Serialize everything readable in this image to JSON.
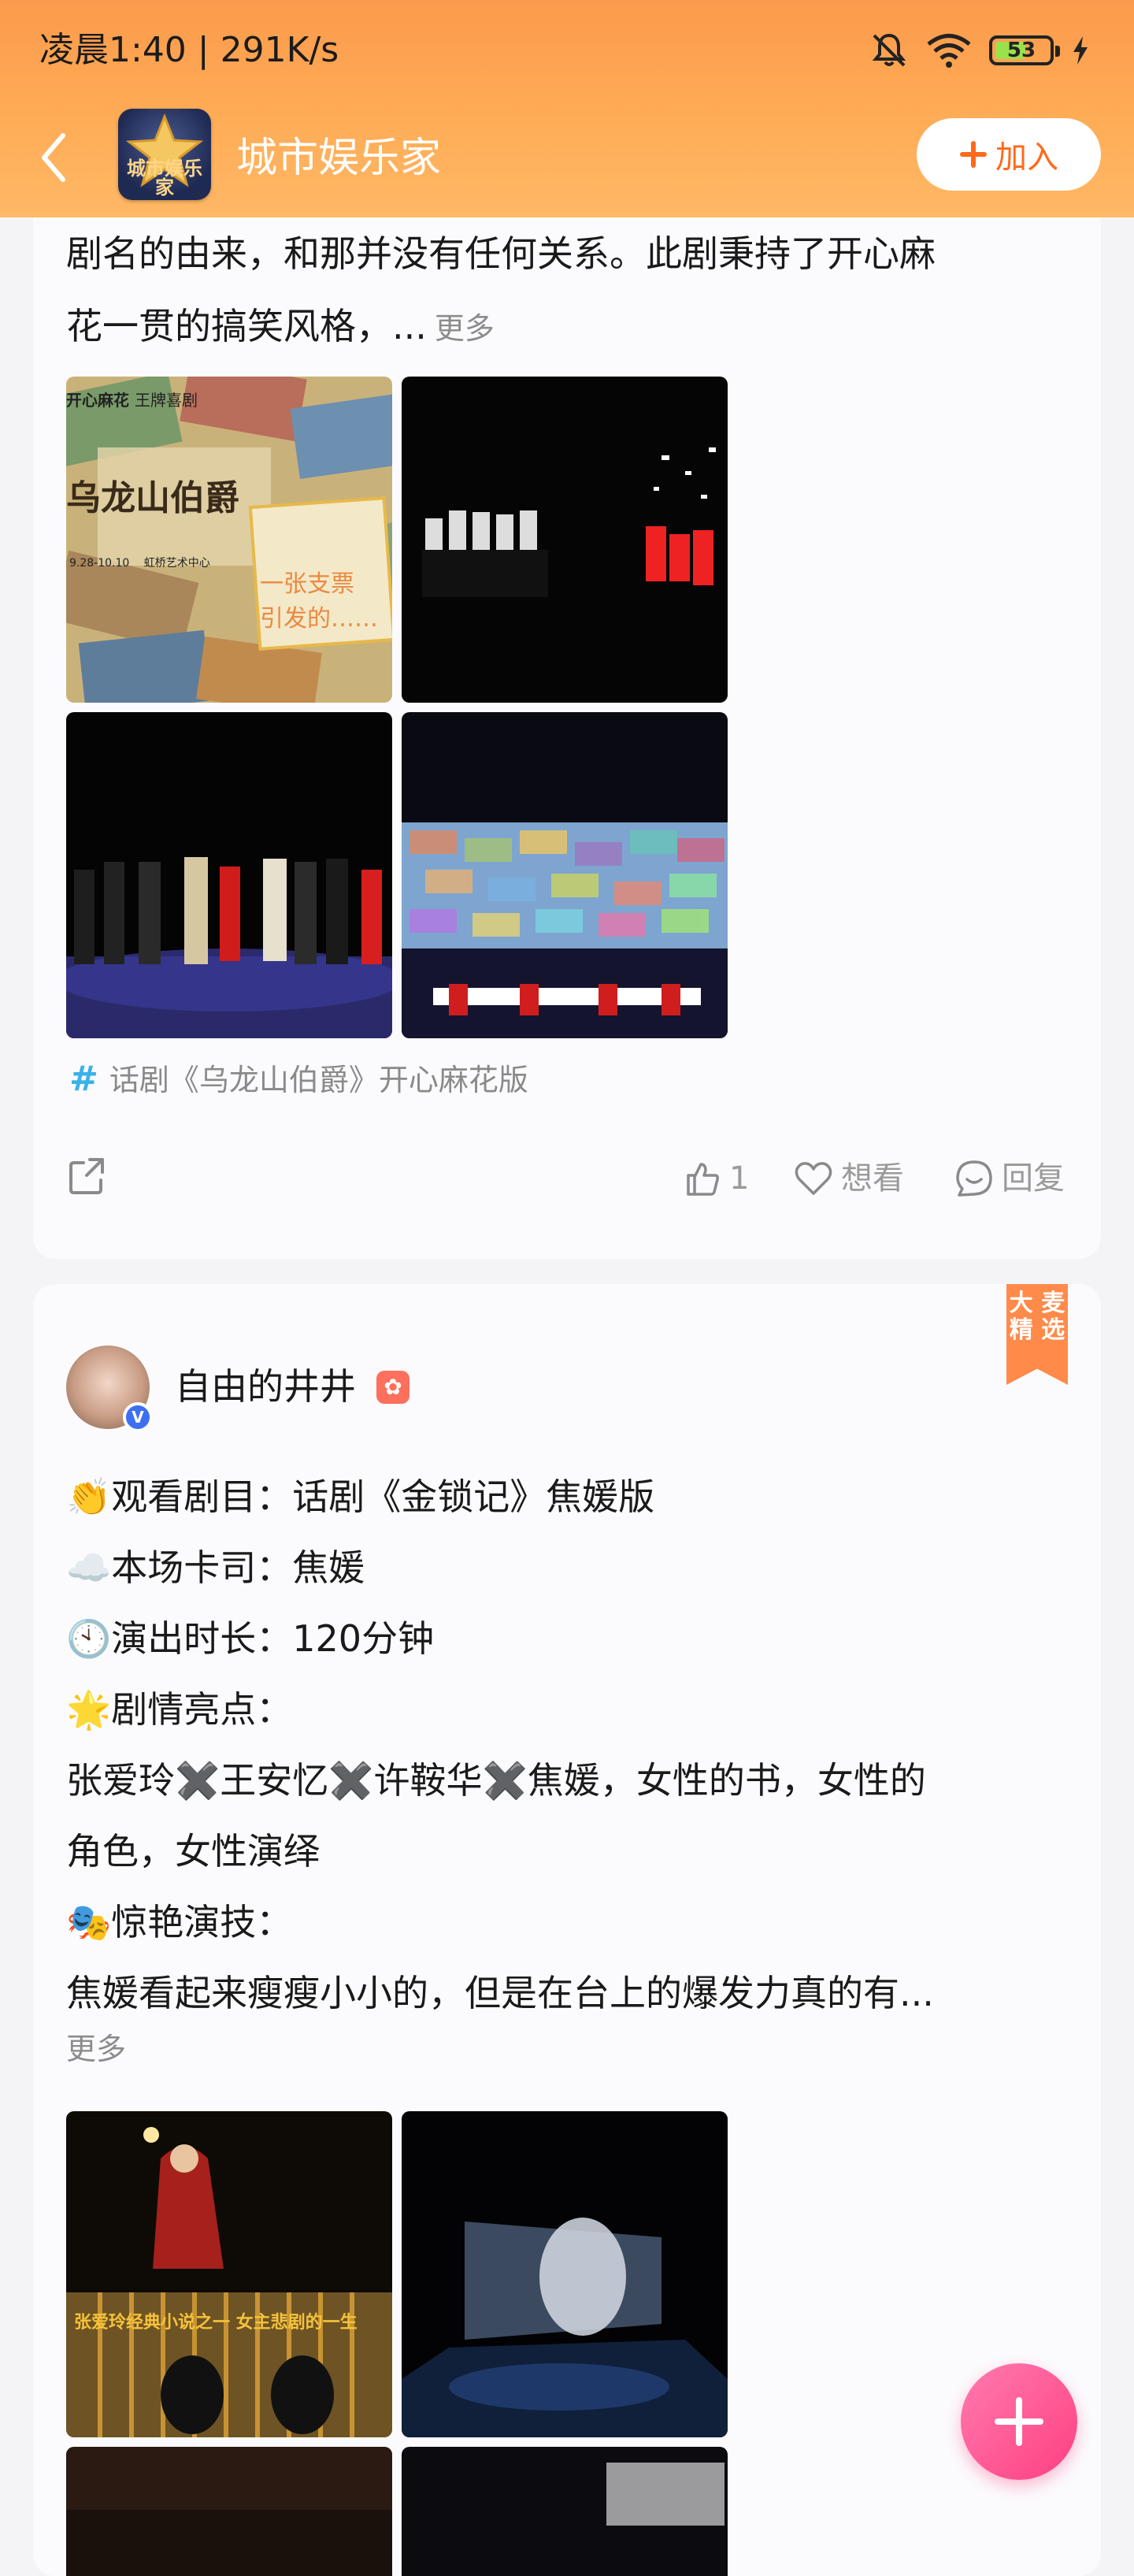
{
  "status_bar": {
    "time_speed": "凌晨1:40 | 291K/s",
    "battery": "53"
  },
  "header": {
    "title": "城市娱乐家",
    "logo_text": "城市娱乐家",
    "join_label": "加入"
  },
  "post1": {
    "lines": [
      "剧名的由来，和那并没有任何关系。此剧秉持了开心麻",
      "花一贯的搞笑风格，..."
    ],
    "more": "更多",
    "poster": {
      "brand": "开心麻花",
      "subtitle": "王牌喜剧",
      "title_art": "乌龙山伯爵",
      "dates": "9.28-10.10",
      "venue": "虹桥艺术中心",
      "slogan_1": "一张支票",
      "slogan_2": "引发的……"
    },
    "tag": "话剧《乌龙山伯爵》开心麻花版",
    "likes": "1",
    "want_label": "想看",
    "reply_label": "回复"
  },
  "post2": {
    "badge_line1": "大 麦",
    "badge_line2": "精 选",
    "user_name": "自由的井井",
    "lines": [
      "👏观看剧目：话剧《金锁记》焦媛版",
      "☁️本场卡司：焦媛",
      "🕙演出时长：120分钟",
      "🌟剧情亮点：",
      "张爱玲✖️王安忆✖️许鞍华✖️焦媛，女性的书，女性的",
      "角色，女性演绎",
      "🎭惊艳演技：",
      "焦媛看起来瘦瘦小小的，但是在台上的爆发力真的有..."
    ],
    "more": "更多",
    "photo_caption": "张爱玲经典小说之一 女主悲剧的一生"
  },
  "colors": {
    "accent": "#ff6a1a",
    "header_top": "#fb9a4c",
    "fab": "#ff3f80",
    "tag_hash": "#3bb1e8"
  },
  "icons": [
    "mute-bell-icon",
    "wifi-icon",
    "battery-icon",
    "charging-icon",
    "back-arrow-icon",
    "plus-icon",
    "hashtag-icon",
    "share-icon",
    "thumb-up-icon",
    "heart-icon",
    "reply-icon",
    "verified-icon",
    "fab-plus-icon"
  ]
}
